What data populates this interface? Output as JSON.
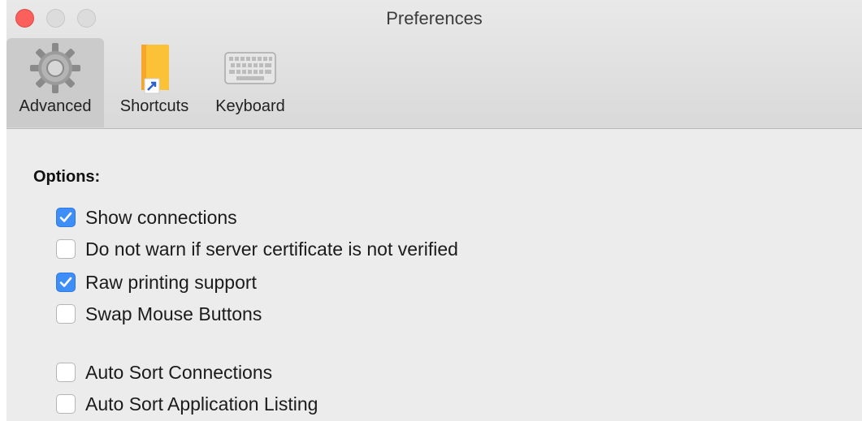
{
  "window": {
    "title": "Preferences"
  },
  "toolbar": {
    "tabs": [
      {
        "label": "Advanced",
        "icon": "gear-icon",
        "selected": true
      },
      {
        "label": "Shortcuts",
        "icon": "folder-shortcut-icon",
        "selected": false
      },
      {
        "label": "Keyboard",
        "icon": "keyboard-icon",
        "selected": false
      }
    ]
  },
  "options": {
    "heading": "Options:",
    "items": [
      {
        "label": "Show connections",
        "checked": true
      },
      {
        "label": "Do not warn if server certificate is not verified",
        "checked": false
      },
      {
        "label": "Raw printing support",
        "checked": true
      },
      {
        "label": "Swap Mouse Buttons",
        "checked": false
      },
      {
        "label": "Auto Sort Connections",
        "checked": false
      },
      {
        "label": "Auto Sort Application Listing",
        "checked": false
      }
    ]
  },
  "colors": {
    "accent": "#3d8ef7",
    "close_button": "#fc605c",
    "window_background": "#ececec"
  }
}
